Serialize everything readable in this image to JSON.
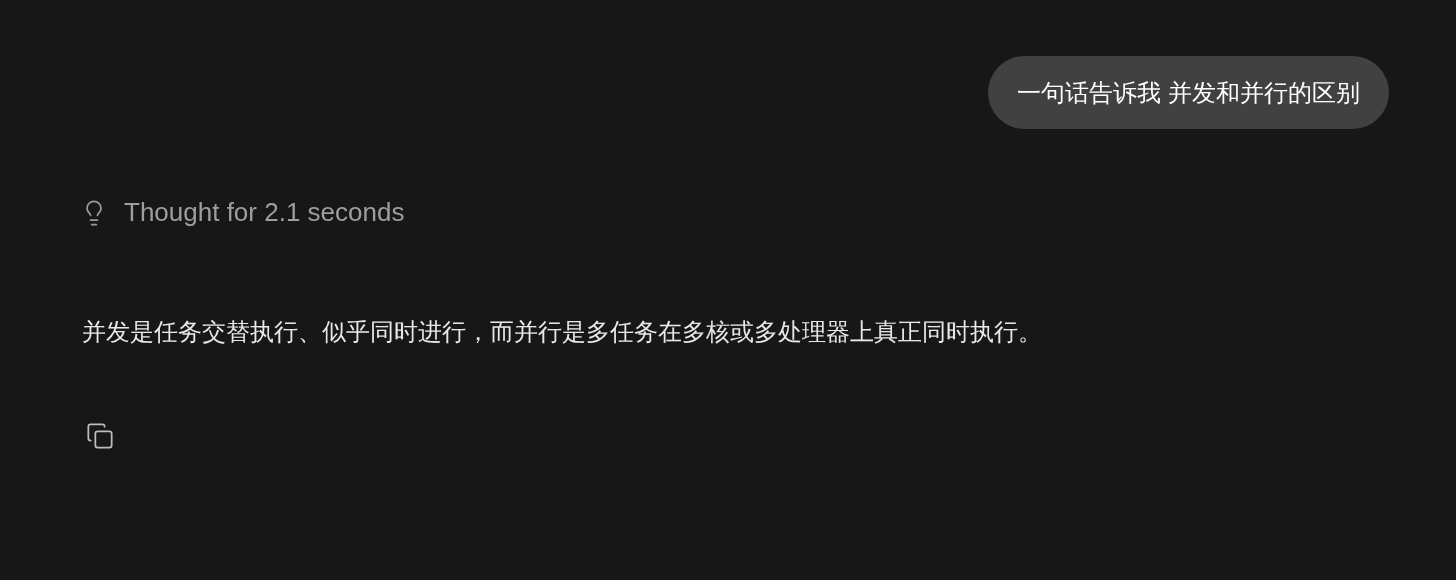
{
  "user_message": {
    "text": "一句话告诉我 并发和并行的区别"
  },
  "thought": {
    "label": "Thought for 2.1 seconds"
  },
  "answer": {
    "text": "并发是任务交替执行、似乎同时进行，而并行是多任务在多核或多处理器上真正同时执行。"
  }
}
